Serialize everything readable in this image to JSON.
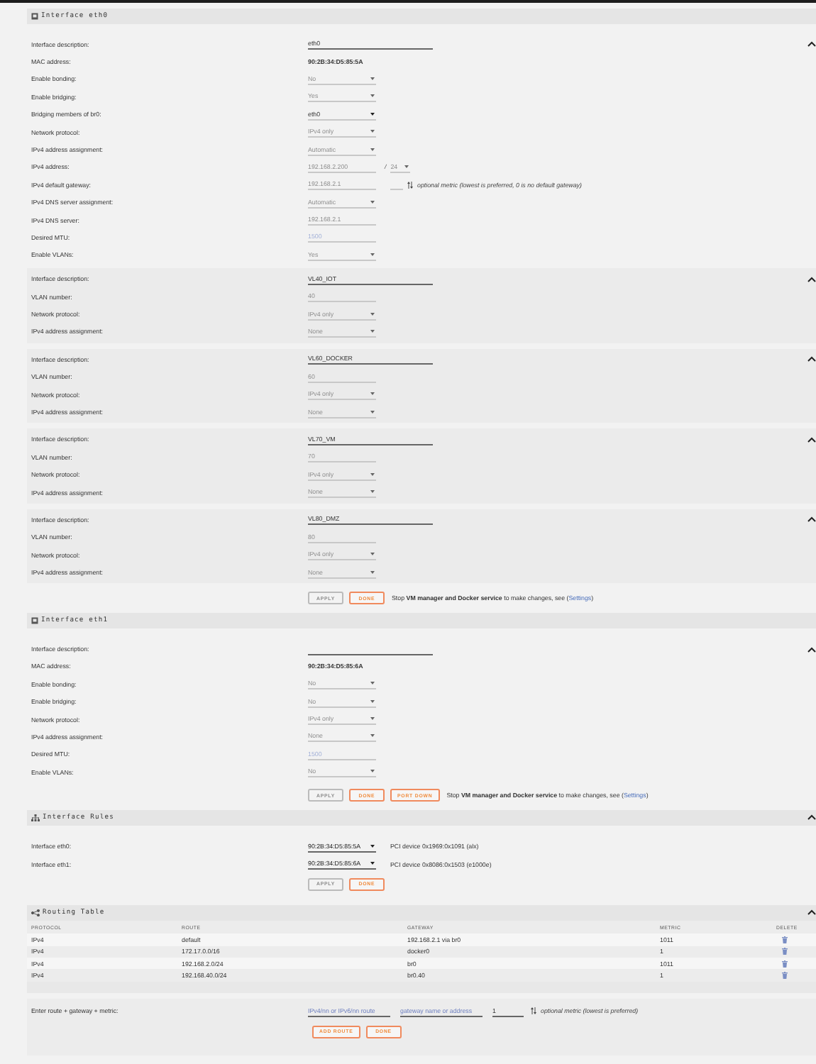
{
  "sections": [
    {
      "kind": "interface",
      "title": "Interface eth0",
      "groups": [
        {
          "kind": "main",
          "rows": [
            {
              "label": "Interface description:",
              "kind": "text",
              "value": "eth0",
              "collapse": true
            },
            {
              "label": "MAC address:",
              "kind": "static",
              "value": "90:2B:34:D5:85:5A"
            },
            {
              "label": "Enable bonding:",
              "kind": "select",
              "value": "No",
              "disabled": true
            },
            {
              "label": "Enable bridging:",
              "kind": "select",
              "value": "Yes",
              "disabled": true
            },
            {
              "label": "Bridging members of br0:",
              "kind": "select",
              "value": "eth0",
              "disabled": false
            },
            {
              "label": "Network protocol:",
              "kind": "select",
              "value": "IPv4 only",
              "disabled": true
            },
            {
              "label": "IPv4 address assignment:",
              "kind": "select",
              "value": "Automatic",
              "disabled": true
            },
            {
              "label": "IPv4 address:",
              "kind": "ip",
              "value": "192.168.2.200",
              "separator": "/",
              "mask": "24",
              "disabled": true
            },
            {
              "label": "IPv4 default gateway:",
              "kind": "gateway",
              "value": "192.168.2.1",
              "note": "optional metric (lowest is preferred, 0 is no default gateway)",
              "disabled": true
            },
            {
              "label": "IPv4 DNS server assignment:",
              "kind": "select",
              "value": "Automatic",
              "disabled": true
            },
            {
              "label": "IPv4 DNS server:",
              "kind": "input",
              "value": "192.168.2.1",
              "disabled": true
            },
            {
              "label": "Desired MTU:",
              "kind": "input",
              "placeholder": "1500",
              "disabled": true
            },
            {
              "label": "Enable VLANs:",
              "kind": "select",
              "value": "Yes",
              "disabled": true
            }
          ]
        },
        {
          "kind": "vlan",
          "rows": [
            {
              "label": "Interface description:",
              "kind": "text",
              "value": "VL40_IOT",
              "collapse": true
            },
            {
              "label": "VLAN number:",
              "kind": "input",
              "value": "40",
              "disabled": true
            },
            {
              "label": "Network protocol:",
              "kind": "select",
              "value": "IPv4 only",
              "disabled": true
            },
            {
              "label": "IPv4 address assignment:",
              "kind": "select",
              "value": "None",
              "disabled": true
            }
          ]
        },
        {
          "kind": "vlan",
          "rows": [
            {
              "label": "Interface description:",
              "kind": "text",
              "value": "VL60_DOCKER",
              "collapse": true
            },
            {
              "label": "VLAN number:",
              "kind": "input",
              "value": "60",
              "disabled": true
            },
            {
              "label": "Network protocol:",
              "kind": "select",
              "value": "IPv4 only",
              "disabled": true
            },
            {
              "label": "IPv4 address assignment:",
              "kind": "select",
              "value": "None",
              "disabled": true
            }
          ]
        },
        {
          "kind": "vlan",
          "rows": [
            {
              "label": "Interface description:",
              "kind": "text",
              "value": "VL70_VM",
              "collapse": true
            },
            {
              "label": "VLAN number:",
              "kind": "input",
              "value": "70",
              "disabled": true
            },
            {
              "label": "Network protocol:",
              "kind": "select",
              "value": "IPv4 only",
              "disabled": true
            },
            {
              "label": "IPv4 address assignment:",
              "kind": "select",
              "value": "None",
              "disabled": true
            }
          ]
        },
        {
          "kind": "vlan",
          "rows": [
            {
              "label": "Interface description:",
              "kind": "text",
              "value": "VL80_DMZ",
              "collapse": true
            },
            {
              "label": "VLAN number:",
              "kind": "input",
              "value": "80",
              "disabled": true
            },
            {
              "label": "Network protocol:",
              "kind": "select",
              "value": "IPv4 only",
              "disabled": true
            },
            {
              "label": "IPv4 address assignment:",
              "kind": "select",
              "value": "None",
              "disabled": true
            }
          ]
        }
      ],
      "buttons": [
        {
          "label": "APPLY",
          "disabled": true
        },
        {
          "label": "DONE",
          "disabled": false
        }
      ],
      "note": {
        "text": "Stop **VM manager and Docker service** to make changes, see (",
        "link": "Settings",
        "end": ")"
      }
    },
    {
      "kind": "interface",
      "title": "Interface eth1",
      "groups": [
        {
          "kind": "main",
          "rows": [
            {
              "label": "Interface description:",
              "kind": "text",
              "collapse": true
            },
            {
              "label": "MAC address:",
              "kind": "static",
              "value": "90:2B:34:D5:85:6A"
            },
            {
              "label": "Enable bonding:",
              "kind": "select",
              "value": "No",
              "disabled": true
            },
            {
              "label": "Enable bridging:",
              "kind": "select",
              "value": "No",
              "disabled": true
            },
            {
              "label": "Network protocol:",
              "kind": "select",
              "value": "IPv4 only",
              "disabled": true
            },
            {
              "label": "IPv4 address assignment:",
              "kind": "select",
              "value": "None",
              "disabled": true
            },
            {
              "label": "Desired MTU:",
              "kind": "input",
              "placeholder": "1500",
              "disabled": true
            },
            {
              "label": "Enable VLANs:",
              "kind": "select",
              "value": "No",
              "disabled": true
            }
          ]
        }
      ],
      "buttons": [
        {
          "label": "APPLY",
          "disabled": true
        },
        {
          "label": "DONE",
          "disabled": false
        },
        {
          "label": "PORT DOWN",
          "disabled": false
        }
      ],
      "note": {
        "text": "Stop **VM manager and Docker service** to make changes, see (",
        "link": "Settings",
        "end": ")"
      }
    },
    {
      "kind": "rules",
      "title": "Interface Rules",
      "groups": [
        {
          "kind": "main",
          "rows": [
            {
              "label": "Interface eth0:",
              "kind": "select",
              "value": "90:2B:34:D5:85:5A",
              "disabled": false,
              "note": "PCI device 0x1969:0x1091 (alx)"
            },
            {
              "label": "Interface eth1:",
              "kind": "select",
              "value": "90:2B:34:D5:85:6A",
              "disabled": false,
              "note": "PCI device 0x8086:0x1503 (e1000e)"
            }
          ]
        }
      ],
      "buttons": [
        {
          "label": "APPLY",
          "disabled": true
        },
        {
          "label": "DONE",
          "disabled": false
        }
      ]
    },
    {
      "kind": "routing",
      "title": "Routing Table",
      "columns": [
        "PROTOCOL",
        "ROUTE",
        "GATEWAY",
        "METRIC",
        "DELETE"
      ],
      "rows": [
        {
          "protocol": "IPv4",
          "route": "default",
          "gateway": "192.168.2.1 via br0",
          "metric": "1011"
        },
        {
          "protocol": "IPv4",
          "route": "172.17.0.0/16",
          "gateway": "docker0",
          "metric": "1"
        },
        {
          "protocol": "IPv4",
          "route": "192.168.2.0/24",
          "gateway": "br0",
          "metric": "1011"
        },
        {
          "protocol": "IPv4",
          "route": "192.168.40.0/24",
          "gateway": "br0.40",
          "metric": "1"
        }
      ],
      "add_route": {
        "label": "Enter route + gateway + metric:",
        "route_placeholder": "IPv4/nn or IPv6/nn route",
        "gateway_placeholder": "gateway name or address",
        "metric": "1",
        "note": "optional metric (lowest is preferred)",
        "buttons": [
          {
            "label": "ADD ROUTE",
            "disabled": false
          },
          {
            "label": "DONE",
            "disabled": false
          }
        ]
      }
    }
  ]
}
